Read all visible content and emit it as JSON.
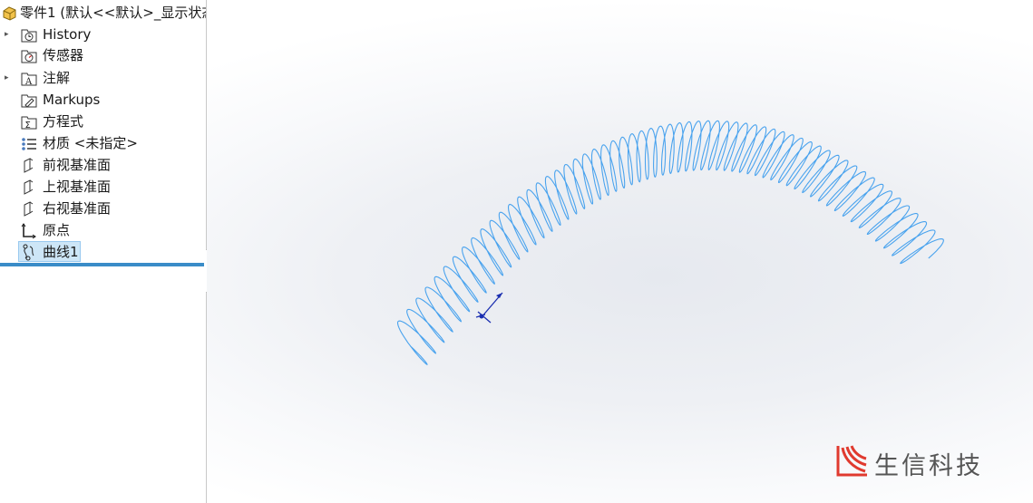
{
  "tree": {
    "root": "零件1  (默认<<默认>_显示状态",
    "items": [
      {
        "label": "History",
        "icon": "history-folder-icon",
        "expandable": true
      },
      {
        "label": "传感器",
        "icon": "sensor-icon",
        "expandable": false
      },
      {
        "label": "注解",
        "icon": "annotations-icon",
        "expandable": true
      },
      {
        "label": "Markups",
        "icon": "markups-icon",
        "expandable": false
      },
      {
        "label": "方程式",
        "icon": "equations-icon",
        "expandable": false
      },
      {
        "label": "材质 <未指定>",
        "icon": "material-icon",
        "expandable": false
      },
      {
        "label": "前视基准面",
        "icon": "plane-icon",
        "expandable": false
      },
      {
        "label": "上视基准面",
        "icon": "plane-icon",
        "expandable": false
      },
      {
        "label": "右视基准面",
        "icon": "plane-icon",
        "expandable": false
      },
      {
        "label": "原点",
        "icon": "origin-icon",
        "expandable": false
      },
      {
        "label": "曲线1",
        "icon": "curve-icon",
        "expandable": false,
        "selected": true
      }
    ]
  },
  "viewport": {
    "curve_color": "#4aa3ee",
    "triad_color": "#1b2fb0"
  },
  "logo": {
    "text": "生信科技",
    "mark_color": "#e03a2f"
  }
}
